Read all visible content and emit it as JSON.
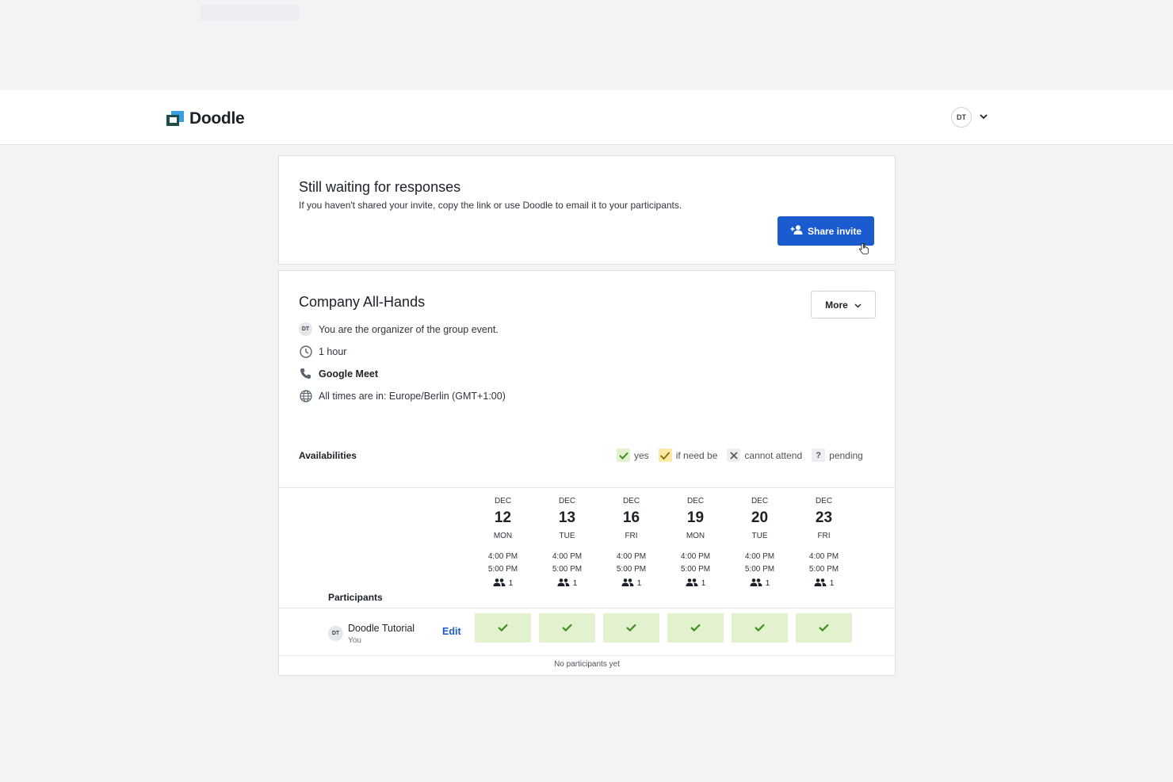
{
  "header": {
    "brand": "Doodle",
    "user_initials": "DT"
  },
  "status_card": {
    "title": "Still waiting for responses",
    "subtitle": "If you haven't shared your invite, copy the link or use Doodle to email it to your participants.",
    "share_button": "Share invite"
  },
  "event": {
    "title": "Company All-Hands",
    "more_button": "More",
    "organizer_initials": "DT",
    "organizer_text": "You are the organizer of the group event.",
    "duration": "1 hour",
    "location": "Google Meet",
    "timezone": "All times are in: Europe/Berlin (GMT+1:00)"
  },
  "availabilities": {
    "label": "Availabilities",
    "legend": {
      "yes": "yes",
      "maybe": "if need be",
      "no": "cannot attend",
      "pending": "pending"
    },
    "participants_header": "Participants",
    "dates": [
      {
        "month": "DEC",
        "day": "12",
        "weekday": "MON",
        "start": "4:00 PM",
        "end": "5:00 PM",
        "count": "1"
      },
      {
        "month": "DEC",
        "day": "13",
        "weekday": "TUE",
        "start": "4:00 PM",
        "end": "5:00 PM",
        "count": "1"
      },
      {
        "month": "DEC",
        "day": "16",
        "weekday": "FRI",
        "start": "4:00 PM",
        "end": "5:00 PM",
        "count": "1"
      },
      {
        "month": "DEC",
        "day": "19",
        "weekday": "MON",
        "start": "4:00 PM",
        "end": "5:00 PM",
        "count": "1"
      },
      {
        "month": "DEC",
        "day": "20",
        "weekday": "TUE",
        "start": "4:00 PM",
        "end": "5:00 PM",
        "count": "1"
      },
      {
        "month": "DEC",
        "day": "23",
        "weekday": "FRI",
        "start": "4:00 PM",
        "end": "5:00 PM",
        "count": "1"
      }
    ],
    "participant": {
      "initials": "DT",
      "name": "Doodle Tutorial",
      "sub": "You",
      "edit": "Edit",
      "votes": [
        "yes",
        "yes",
        "yes",
        "yes",
        "yes",
        "yes"
      ]
    },
    "empty_text": "No participants yet"
  },
  "colors": {
    "primary": "#1a5ccf",
    "yes_bg": "#e2f2cf",
    "yes_check": "#3e8e1e"
  }
}
